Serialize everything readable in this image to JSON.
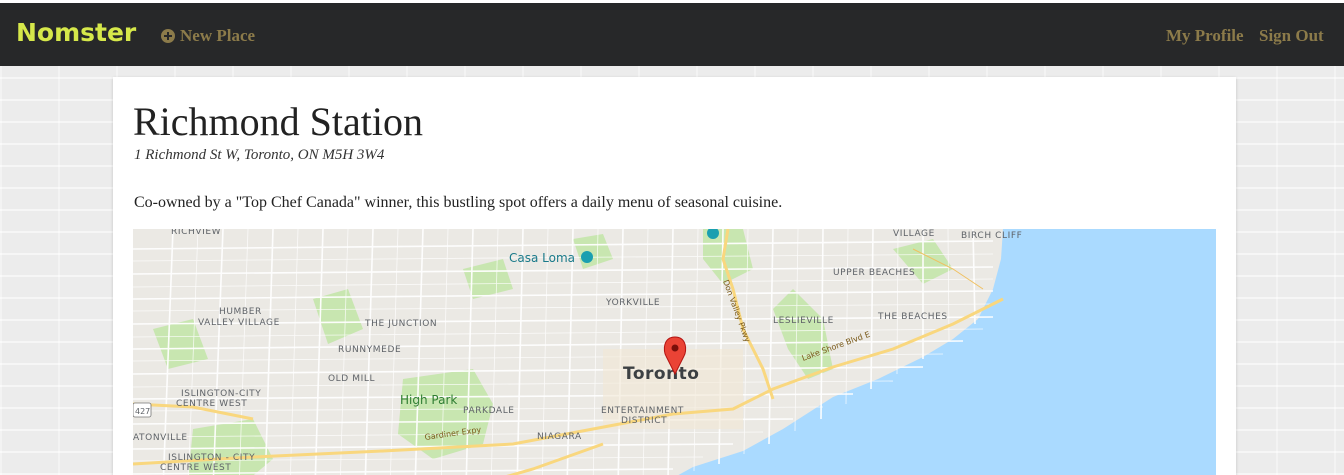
{
  "navbar": {
    "brand": "Nomster",
    "new_place": "New Place",
    "my_profile": "My Profile",
    "sign_out": "Sign Out"
  },
  "place": {
    "name": "Richmond Station",
    "address": "1 Richmond St W, Toronto, ON M5H 3W4",
    "description": "Co-owned by a \"Top Chef Canada\" winner, this bustling spot offers a daily menu of seasonal cuisine."
  },
  "map": {
    "city": "Toronto",
    "labels": {
      "richview": "RICHVIEW",
      "casa_loma": "Casa Loma",
      "village": "VILLAGE",
      "birch_cliff": "BIRCH CLIFF",
      "upper_beaches": "UPPER BEACHES",
      "yorkville": "YORKVILLE",
      "don_valley": "Don Valley Pkwy",
      "humber_1": "HUMBER",
      "humber_2": "VALLEY VILLAGE",
      "the_junction": "THE JUNCTION",
      "leslieville": "LESLIEVILLE",
      "the_beaches": "THE BEACHES",
      "lake_shore": "Lake Shore Blvd E",
      "runnymede": "RUNNYMEDE",
      "old_mill": "OLD MILL",
      "islington_1": "ISLINGTON-CITY",
      "islington_2": "CENTRE WEST",
      "high_park": "High Park",
      "parkdale": "PARKDALE",
      "entertainment_1": "ENTERTAINMENT",
      "entertainment_2": "DISTRICT",
      "route_427": "427",
      "etonville": "ATONVILLE",
      "gardiner": "Gardiner Expy",
      "niagara": "NIAGARA",
      "islington_3": "ISLINGTON - CITY",
      "islington_4": "CENTRE WEST"
    },
    "colors": {
      "land": "#ebe9e4",
      "water": "#aadaff",
      "park": "#c8e6b0",
      "road": "#ffffff",
      "highway": "#f9d77e",
      "marker": "#ea4335"
    }
  }
}
